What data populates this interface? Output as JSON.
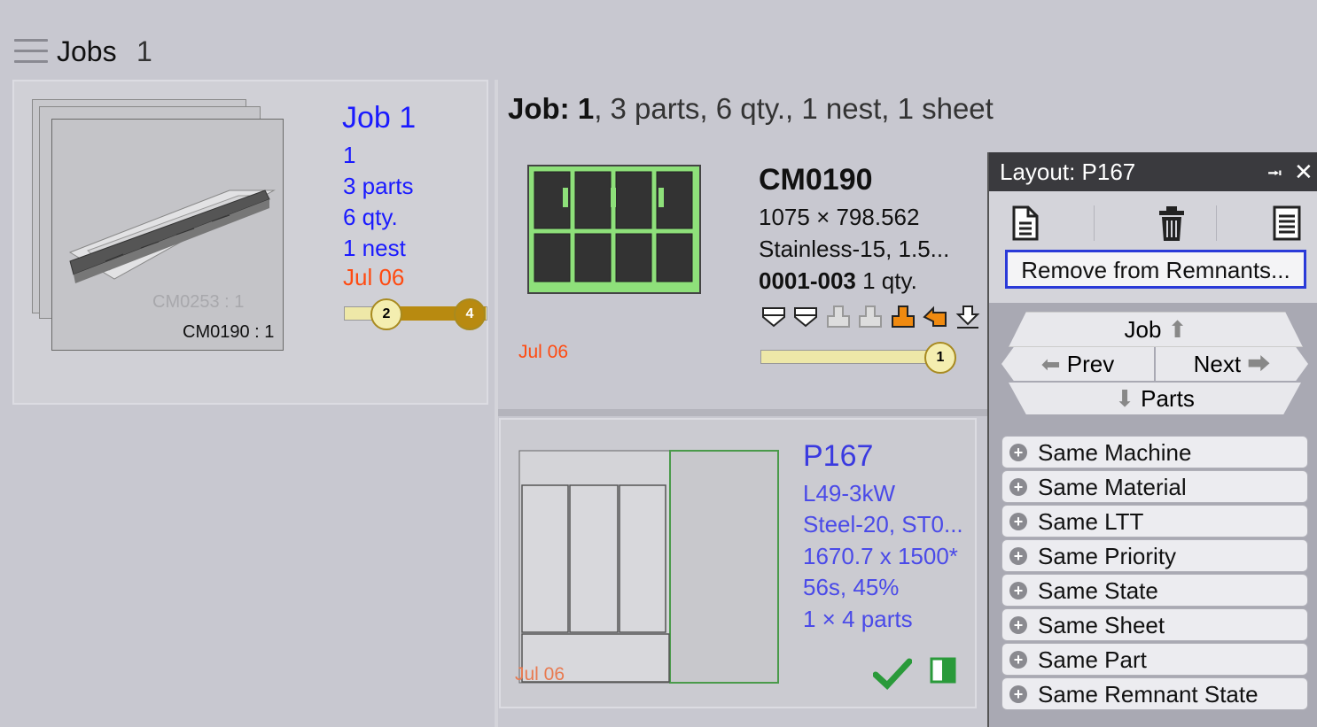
{
  "header": {
    "title": "Jobs",
    "count": "1"
  },
  "job_card": {
    "name": "Job 1",
    "lines": [
      "1",
      "3 parts",
      "6 qty.",
      "1 nest"
    ],
    "date": "Jul 06",
    "thumb_ghost_label": "CM0253 : 1",
    "thumb_label": "CM0190 : 1",
    "progress": {
      "left_value": "2",
      "right_value": "4",
      "fill_fraction": 0.69
    }
  },
  "job_header": {
    "prefix": "Job: 1",
    "rest": ", 3 parts, 6 qty., 1 nest, 1 sheet"
  },
  "part": {
    "name": "CM0190",
    "dims": "1075 × 798.562",
    "material": "Stainless-15, 1.5...",
    "code": "0001-003",
    "qty": "1 qty.",
    "date": "Jul 06",
    "progress_value": "1"
  },
  "nest": {
    "name": "P167",
    "lines": [
      "L49-3kW",
      "Steel-20, ST0...",
      "1670.7 x 1500*",
      "56s, 45%",
      "1 × 4 parts"
    ],
    "date": "Jul 06"
  },
  "layout_panel": {
    "title_label": "Layout:",
    "title_value": "P167",
    "pin_icon": "pin-icon",
    "close_icon": "close-icon",
    "toolbar_icons": [
      "document-icon",
      "trash-icon",
      "report-icon"
    ],
    "remove_button": "Remove from Remnants...",
    "nav": {
      "job": "Job",
      "prev": "Prev",
      "next": "Next",
      "parts": "Parts"
    },
    "filters": [
      "Same Machine",
      "Same Material",
      "Same LTT",
      "Same Priority",
      "Same State",
      "Same Sheet",
      "Same Part",
      "Same Remnant State"
    ]
  },
  "colors": {
    "link_blue": "#1a1aff",
    "date_orange": "#ff4a10",
    "nest_blue": "#3a3ae0",
    "accent_gold": "#b88a10",
    "check_green": "#2a9a3a"
  }
}
